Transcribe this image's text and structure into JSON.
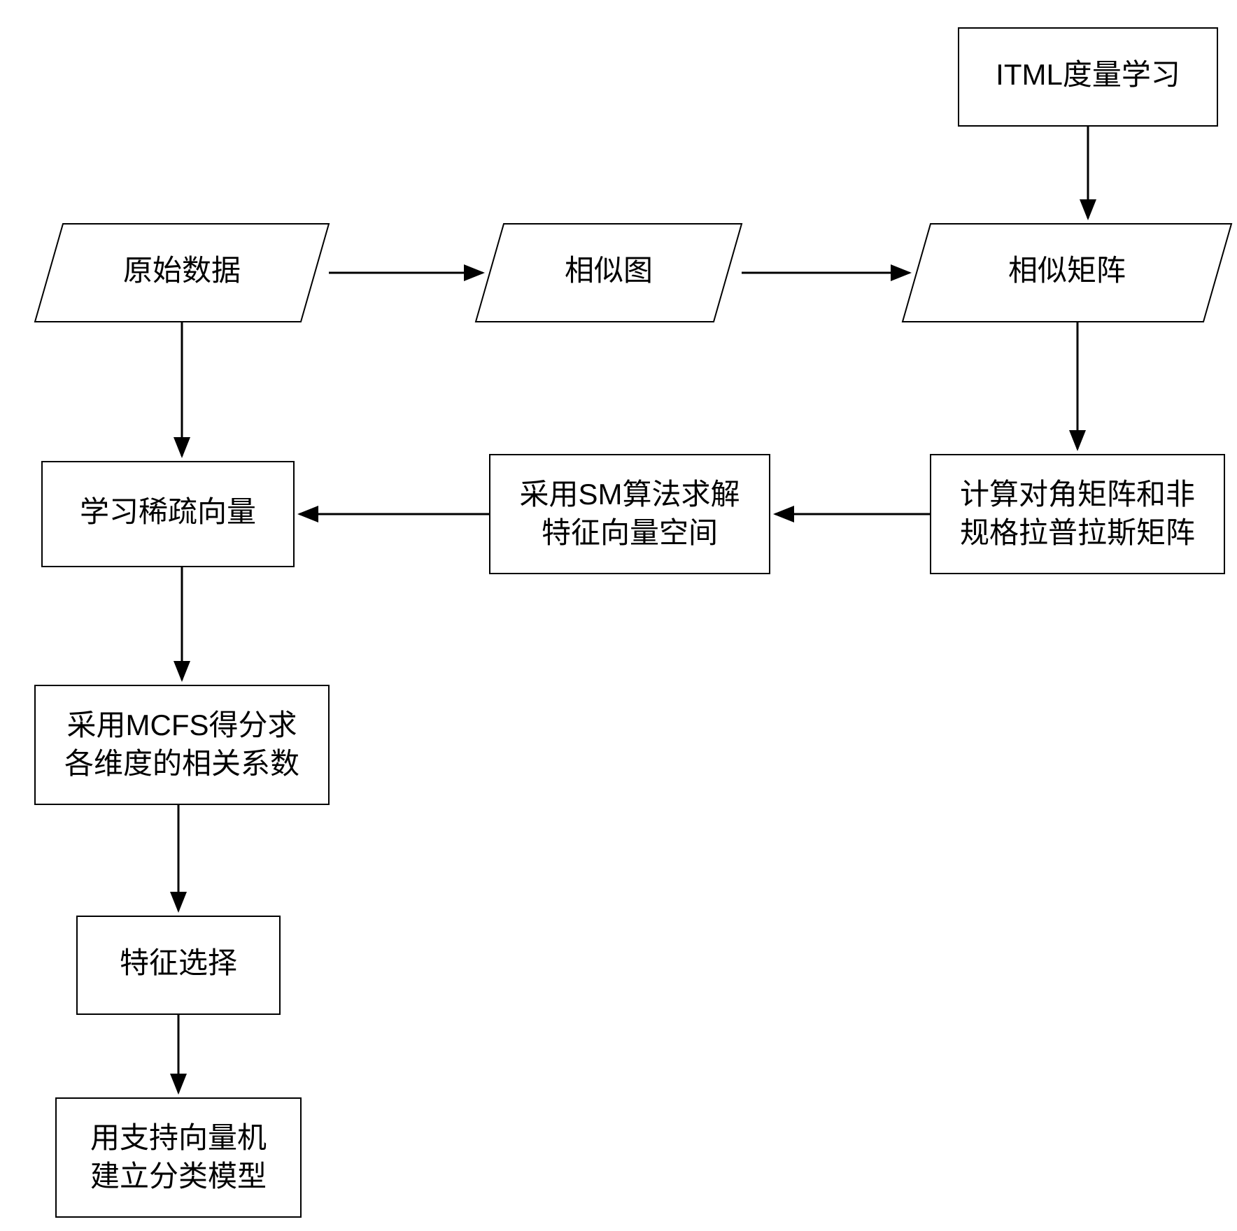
{
  "nodes": {
    "itml": {
      "label1": "ITML度量学习"
    },
    "raw": {
      "label1": "原始数据"
    },
    "simgraph": {
      "label1": "相似图"
    },
    "simmatrix": {
      "label1": "相似矩阵"
    },
    "laplacian": {
      "label1": "计算对角矩阵和非",
      "label2": "规格拉普拉斯矩阵"
    },
    "sm": {
      "label1": "采用SM算法求解",
      "label2": "特征向量空间"
    },
    "sparse": {
      "label1": "学习稀疏向量"
    },
    "mcfs": {
      "label1": "采用MCFS得分求",
      "label2": "各维度的相关系数"
    },
    "featsel": {
      "label1": "特征选择"
    },
    "svm": {
      "label1": "用支持向量机",
      "label2": "建立分类模型"
    }
  }
}
